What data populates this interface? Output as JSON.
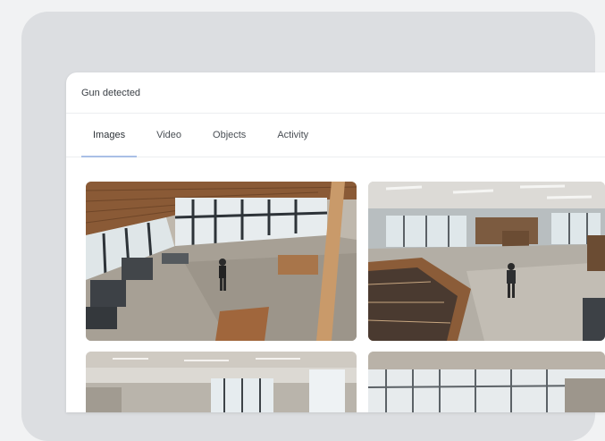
{
  "panel": {
    "title": "Gun detected"
  },
  "tabs": [
    {
      "label": "Images"
    },
    {
      "label": "Video"
    },
    {
      "label": "Objects"
    },
    {
      "label": "Activity"
    }
  ],
  "active_tab": "Images",
  "gallery": {
    "images": [
      {
        "name": "camera-image-lobby"
      },
      {
        "name": "camera-image-library"
      },
      {
        "name": "camera-image-hallway"
      },
      {
        "name": "camera-image-atrium"
      }
    ]
  },
  "colors": {
    "page_bg": "#f1f2f3",
    "backdrop": "#dcdee1",
    "panel_bg": "#ffffff",
    "tab_indicator": "#a9bfe6"
  }
}
